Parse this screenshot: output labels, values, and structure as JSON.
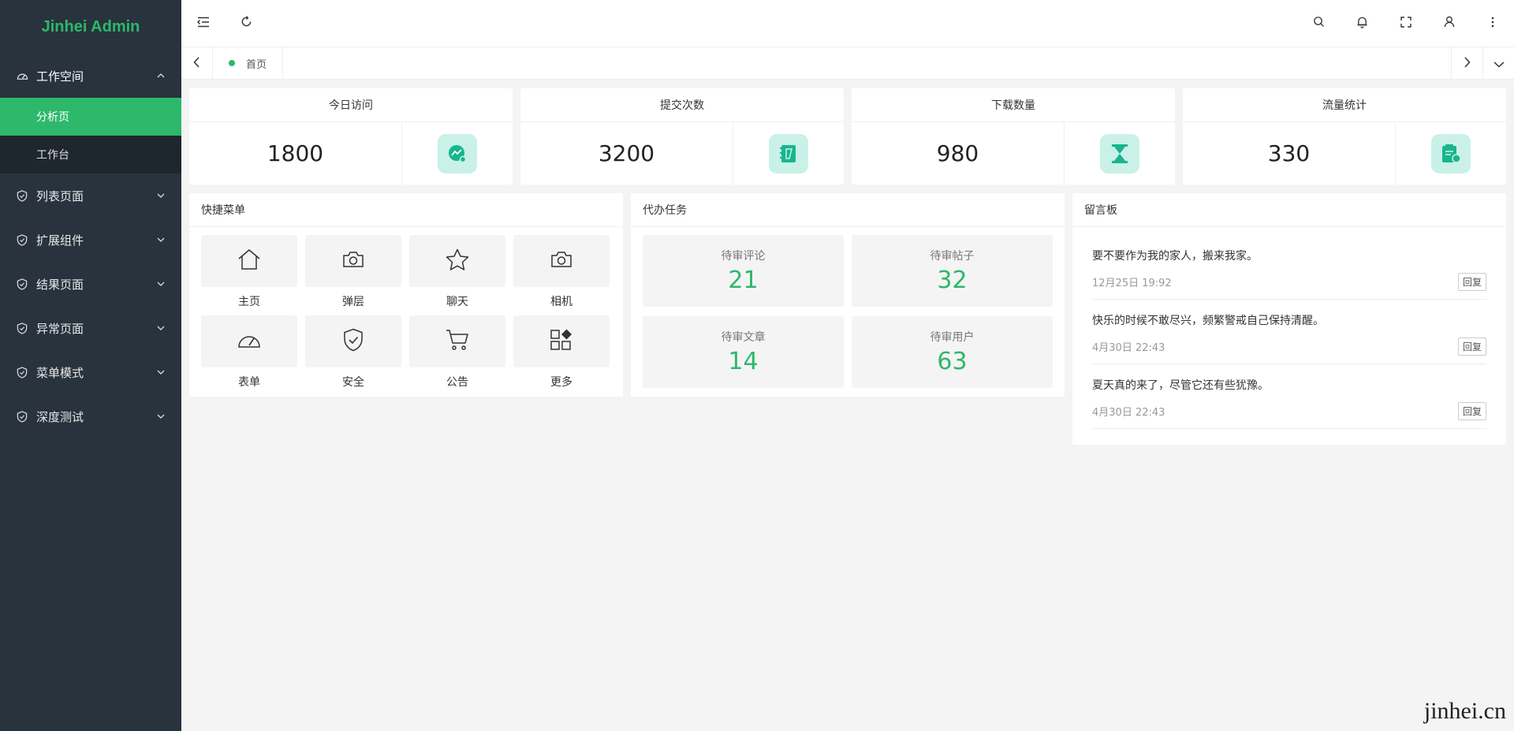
{
  "app": {
    "title": "Jinhei Admin",
    "accent": "#2eb86c",
    "sidebar_bg": "#28333e"
  },
  "sidebar": {
    "items": [
      {
        "label": "工作空间",
        "icon": "dashboard-icon",
        "open": true,
        "children": [
          {
            "label": "分析页",
            "active": true
          },
          {
            "label": "工作台",
            "active": false
          }
        ]
      },
      {
        "label": "列表页面",
        "icon": "shield-check-icon"
      },
      {
        "label": "扩展组件",
        "icon": "shield-check-icon"
      },
      {
        "label": "结果页面",
        "icon": "shield-check-icon"
      },
      {
        "label": "异常页面",
        "icon": "shield-check-icon"
      },
      {
        "label": "菜单模式",
        "icon": "shield-check-icon"
      },
      {
        "label": "深度测试",
        "icon": "shield-check-icon"
      }
    ]
  },
  "header": {
    "left_icons": [
      "menu-fold-icon",
      "refresh-icon"
    ],
    "right_icons": [
      "search-icon",
      "bell-icon",
      "fullscreen-icon",
      "user-icon",
      "more-vertical-icon"
    ]
  },
  "tabs": [
    {
      "label": "首页",
      "active": true
    }
  ],
  "stats": [
    {
      "title": "今日访问",
      "value": "1800",
      "icon": "chart-magnifier-icon"
    },
    {
      "title": "提交次数",
      "value": "3200",
      "icon": "notebook-icon"
    },
    {
      "title": "下载数量",
      "value": "980",
      "icon": "hourglass-icon"
    },
    {
      "title": "流量统计",
      "value": "330",
      "icon": "clipboard-chart-icon"
    }
  ],
  "quick_menu": {
    "title": "快捷菜单",
    "items": [
      {
        "label": "主页",
        "icon": "home-icon"
      },
      {
        "label": "弹层",
        "icon": "camera-icon"
      },
      {
        "label": "聊天",
        "icon": "star-icon"
      },
      {
        "label": "相机",
        "icon": "camera-icon"
      },
      {
        "label": "表单",
        "icon": "gauge-icon"
      },
      {
        "label": "安全",
        "icon": "shield-icon"
      },
      {
        "label": "公告",
        "icon": "cart-icon"
      },
      {
        "label": "更多",
        "icon": "apps-icon"
      }
    ]
  },
  "todo": {
    "title": "代办任务",
    "items": [
      {
        "label": "待审评论",
        "value": "21"
      },
      {
        "label": "待审帖子",
        "value": "32"
      },
      {
        "label": "待审文章",
        "value": "14"
      },
      {
        "label": "待审用户",
        "value": "63"
      }
    ]
  },
  "messages": {
    "title": "留言板",
    "reply_label": "回复",
    "items": [
      {
        "text": "要不要作为我的家人，搬来我家。",
        "time": "12月25日 19:92"
      },
      {
        "text": "快乐的时候不敢尽兴，频繁警戒自己保持清醒。",
        "time": "4月30日 22:43"
      },
      {
        "text": "夏天真的来了，尽管它还有些犹豫。",
        "time": "4月30日 22:43"
      }
    ]
  },
  "watermark": "jinhei.cn"
}
